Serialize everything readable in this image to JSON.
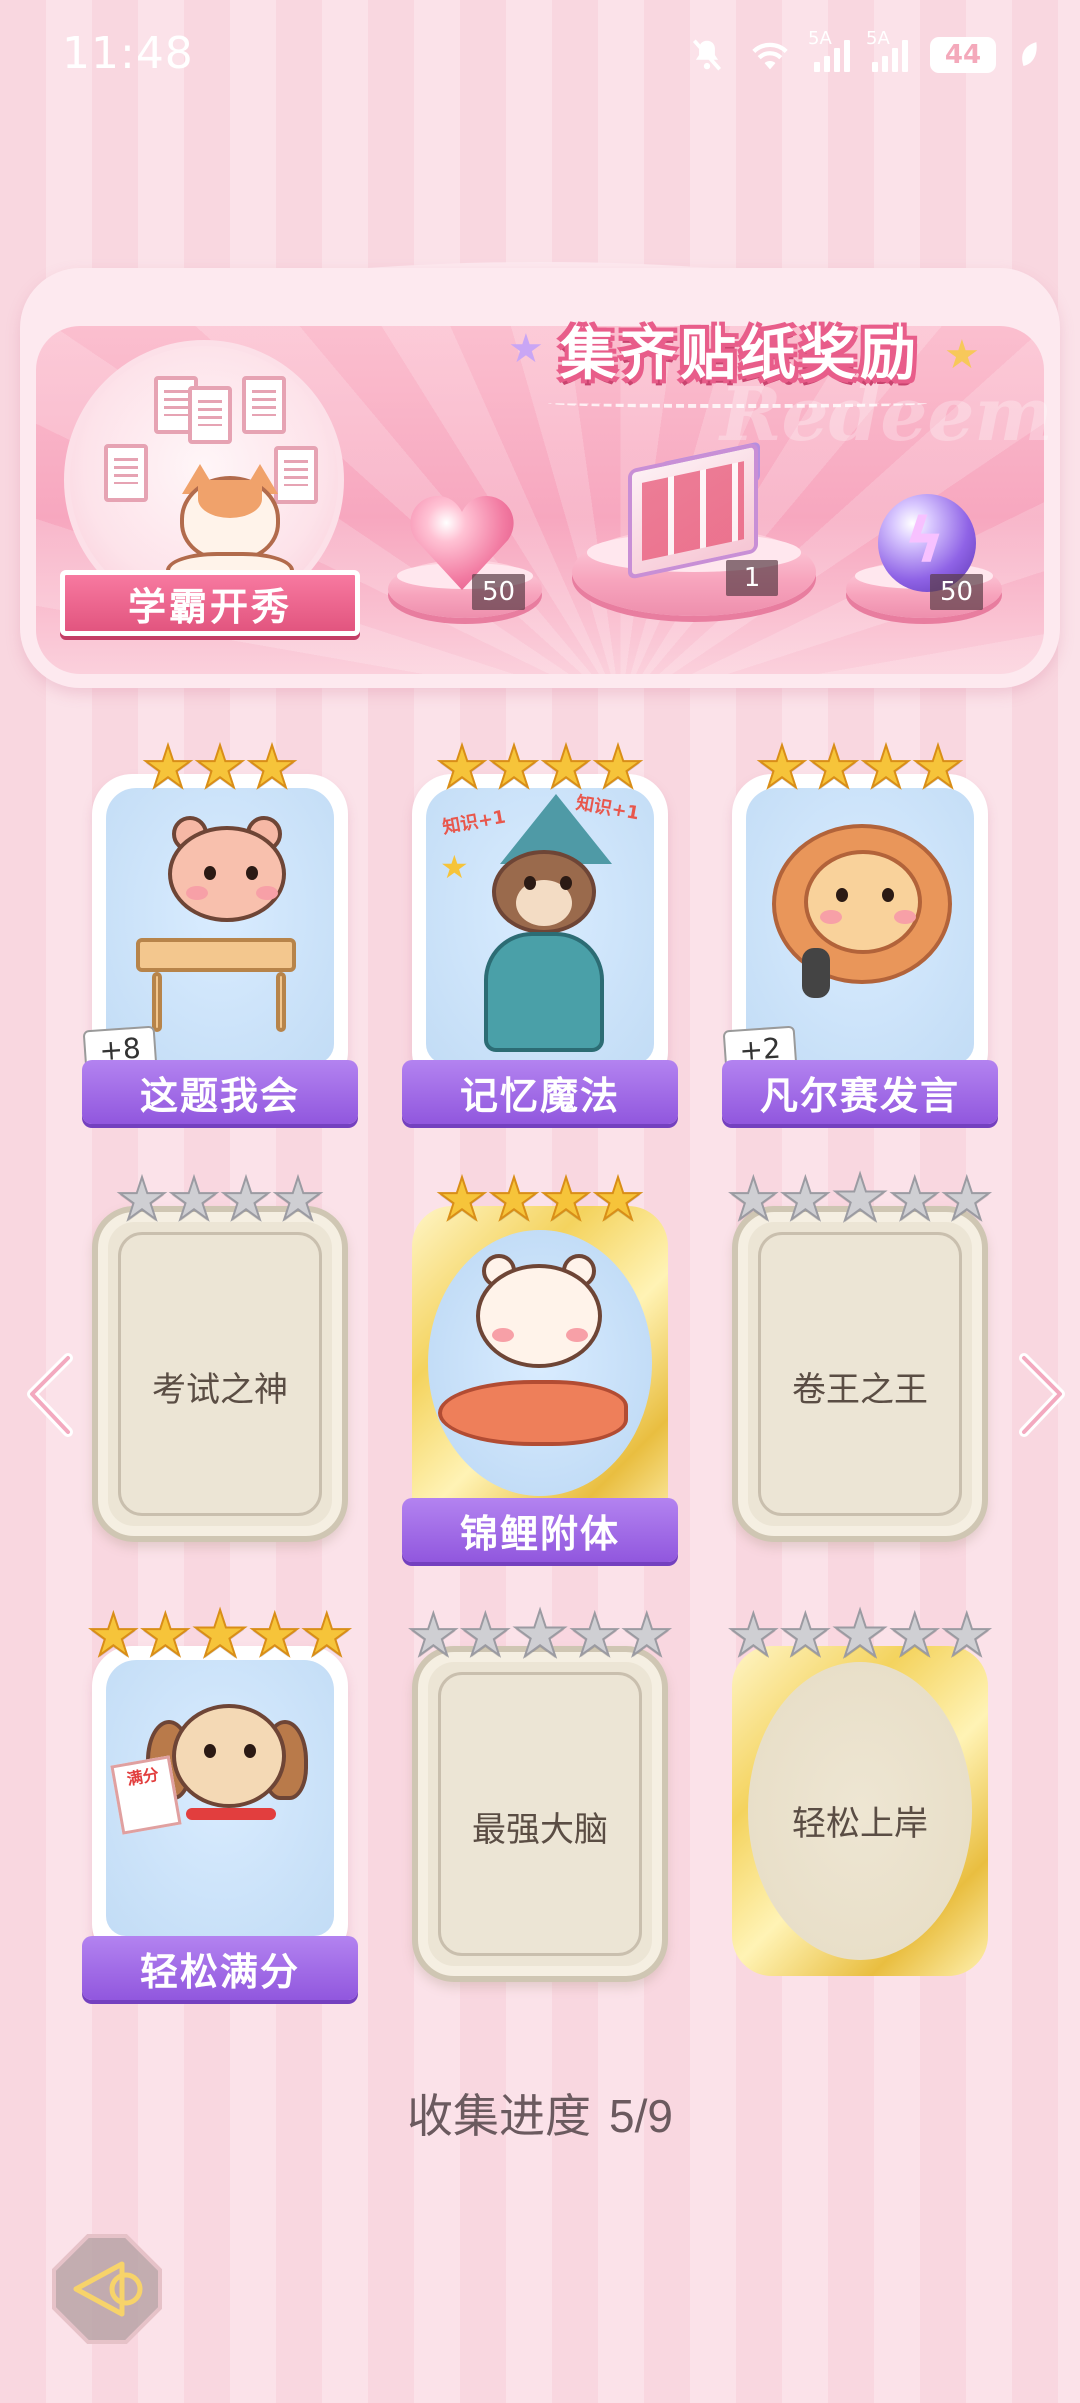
{
  "status_bar": {
    "time": "11:48",
    "network_1": "5A",
    "network_2": "5A",
    "battery": "44"
  },
  "banner": {
    "title": "集齐贴纸奖励",
    "watermark": "Redeem",
    "emblem_label": "学霸开秀",
    "rewards": [
      {
        "icon": "heart-gem-icon",
        "count": "50"
      },
      {
        "icon": "gift-box-icon",
        "count": "1"
      },
      {
        "icon": "energy-orb-icon",
        "count": "50"
      }
    ]
  },
  "stickers": [
    {
      "name": "这题我会",
      "stars": 3,
      "max_stars": 3,
      "collected": true,
      "extra": "+8"
    },
    {
      "name": "记忆魔法",
      "stars": 4,
      "max_stars": 4,
      "collected": true,
      "extra": ""
    },
    {
      "name": "凡尔赛发言",
      "stars": 4,
      "max_stars": 4,
      "collected": true,
      "extra": "+2"
    },
    {
      "name": "考试之神",
      "stars": 0,
      "max_stars": 4,
      "collected": false
    },
    {
      "name": "锦鲤附体",
      "stars": 4,
      "max_stars": 4,
      "collected": true,
      "extra": ""
    },
    {
      "name": "卷王之王",
      "stars": 0,
      "max_stars": 5,
      "collected": false
    },
    {
      "name": "轻松满分",
      "stars": 5,
      "max_stars": 5,
      "collected": true,
      "extra": ""
    },
    {
      "name": "最强大脑",
      "stars": 0,
      "max_stars": 5,
      "collected": false
    },
    {
      "name": "轻松上岸",
      "stars": 0,
      "max_stars": 5,
      "collected": false
    }
  ],
  "art_text": {
    "knowledge_left": "知识+1",
    "knowledge_right": "知识+1",
    "full_marks": "满分"
  },
  "progress": {
    "label": "收集进度",
    "value": "5/9"
  },
  "colors": {
    "accent_pink": "#e85d8a",
    "label_purple": "#9157de",
    "star_gold": "#f6c43a",
    "star_grey": "#cfcfd3"
  }
}
